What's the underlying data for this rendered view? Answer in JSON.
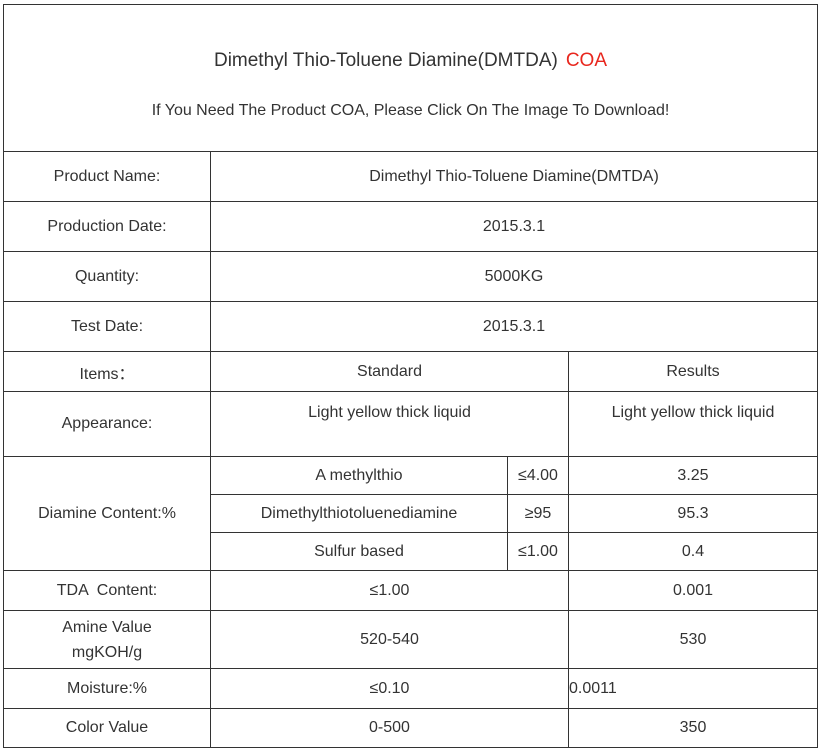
{
  "header": {
    "title": "Dimethyl Thio-Toluene Diamine(DMTDA)",
    "title_highlight": "COA",
    "subtitle": "If You Need The Product COA, Please Click On The Image To Download!"
  },
  "product": {
    "name_label": "Product Name:",
    "name_value": "Dimethyl Thio-Toluene Diamine(DMTDA)",
    "production_label": "Production Date:",
    "production_value": "2015.3.1",
    "quantity_label": "Quantity:",
    "quantity_value": "5000KG",
    "test_label": "Test Date:",
    "test_value": "2015.3.1"
  },
  "items_header": {
    "items": "Items：",
    "standard": "Standard",
    "results": "Results"
  },
  "appearance": {
    "label": "Appearance:",
    "standard": "Light yellow thick liquid",
    "result": "Light yellow thick liquid"
  },
  "diamine": {
    "label": "Diamine Content:%",
    "rows": [
      {
        "name": "A methylthio",
        "standard": "≤4.00",
        "result": "3.25"
      },
      {
        "name": "Dimethylthiotoluenediamine",
        "standard": "≥95",
        "result": "95.3"
      },
      {
        "name": "Sulfur based",
        "standard": "≤1.00",
        "result": "0.4"
      }
    ]
  },
  "tda": {
    "label": "TDA  Content:",
    "standard": "≤1.00",
    "result": "0.001"
  },
  "amine": {
    "label_line1": "Amine Value",
    "label_line2": "mgKOH/g",
    "standard": "520-540",
    "result": "530"
  },
  "moisture": {
    "label": "Moisture:%",
    "standard": "≤0.10",
    "result": "0.0011"
  },
  "color": {
    "label": "Color Value",
    "standard": "0-500",
    "result": "350"
  },
  "colors": {
    "highlight": "#e8271e",
    "link_blue": "#1a1aa6",
    "border": "#333333"
  }
}
